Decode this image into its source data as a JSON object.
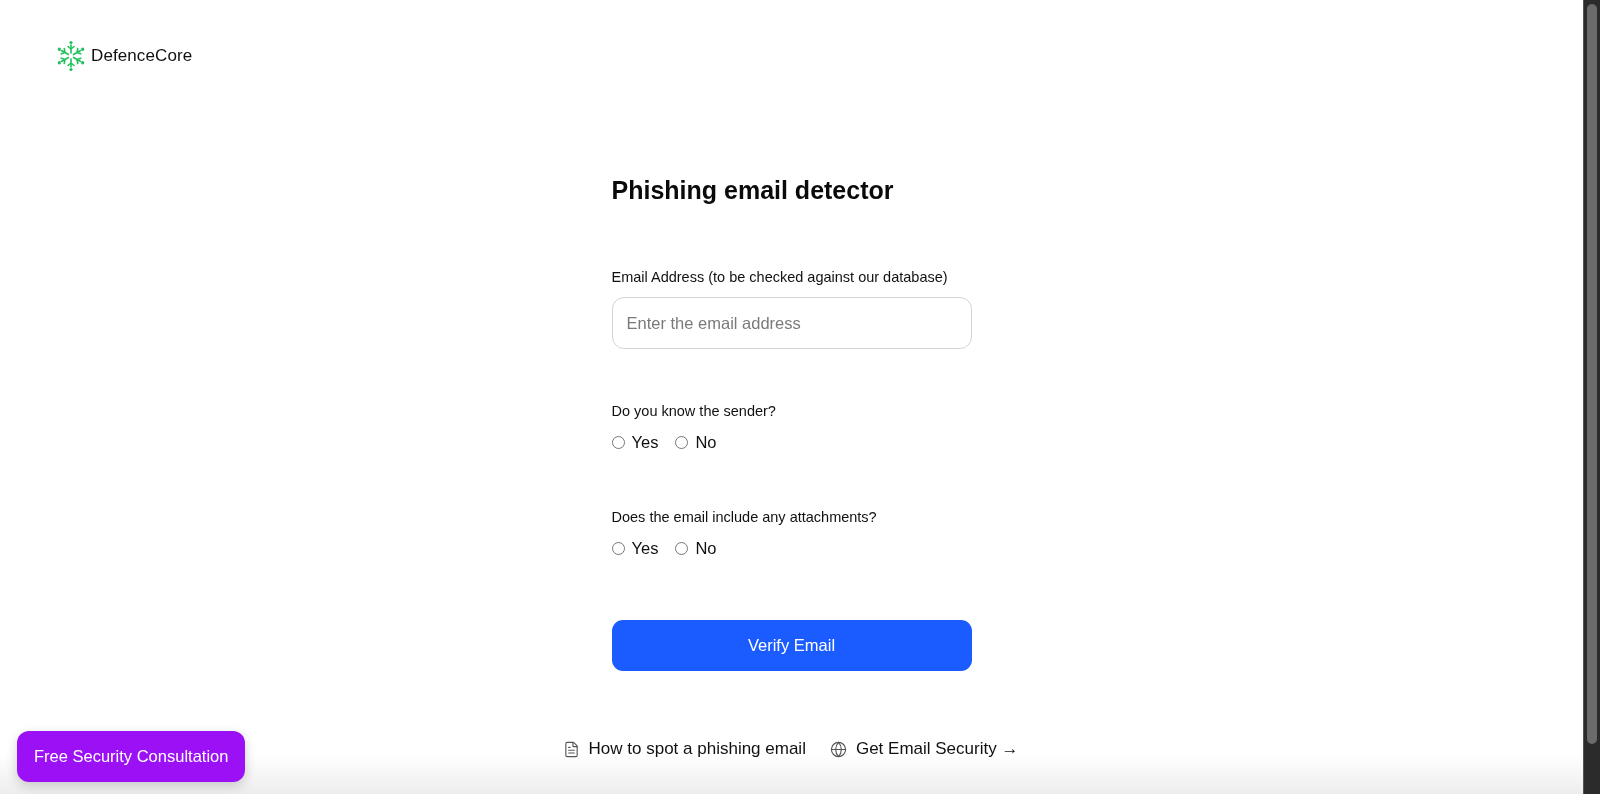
{
  "brand": {
    "name": "DefenceCore"
  },
  "form": {
    "title": "Phishing email detector",
    "email_field": {
      "label": "Email Address (to be checked against our database)",
      "placeholder": "Enter the email address"
    },
    "questions": [
      {
        "label": "Do you know the sender?",
        "options": [
          {
            "label": "Yes",
            "selected": false
          },
          {
            "label": "No",
            "selected": false
          }
        ]
      },
      {
        "label": "Does the email include any attachments?",
        "options": [
          {
            "label": "Yes",
            "selected": false
          },
          {
            "label": "No",
            "selected": false
          }
        ]
      }
    ],
    "submit": {
      "label": "Verify Email"
    }
  },
  "footer_links": [
    {
      "kind": "guide",
      "label": "How to spot a phishing email"
    },
    {
      "kind": "external",
      "label": "Get Email Security →"
    }
  ],
  "consultation_button": {
    "label": "Free Security Consultation"
  }
}
